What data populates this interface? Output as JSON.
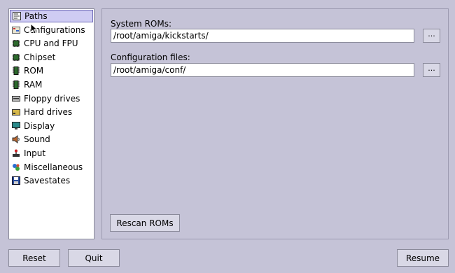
{
  "sidebar": {
    "items": [
      {
        "label": "Paths",
        "icon": "paths-icon",
        "selected": true
      },
      {
        "label": "Configurations",
        "icon": "configurations-icon"
      },
      {
        "label": "CPU and FPU",
        "icon": "chip-icon"
      },
      {
        "label": "Chipset",
        "icon": "chip-icon"
      },
      {
        "label": "ROM",
        "icon": "memory-icon"
      },
      {
        "label": "RAM",
        "icon": "memory-icon"
      },
      {
        "label": "Floppy drives",
        "icon": "floppy-drive-icon"
      },
      {
        "label": "Hard drives",
        "icon": "hard-drive-icon"
      },
      {
        "label": "Display",
        "icon": "monitor-icon"
      },
      {
        "label": "Sound",
        "icon": "sound-icon"
      },
      {
        "label": "Input",
        "icon": "joystick-icon"
      },
      {
        "label": "Miscellaneous",
        "icon": "misc-icon"
      },
      {
        "label": "Savestates",
        "icon": "save-icon"
      }
    ]
  },
  "paths": {
    "system_roms_label": "System ROMs:",
    "system_roms_value": "/root/amiga/kickstarts/",
    "config_files_label": "Configuration files:",
    "config_files_value": "/root/amiga/conf/",
    "browse_label": "...",
    "rescan_label": "Rescan ROMs"
  },
  "footer": {
    "reset_label": "Reset",
    "quit_label": "Quit",
    "resume_label": "Resume"
  }
}
